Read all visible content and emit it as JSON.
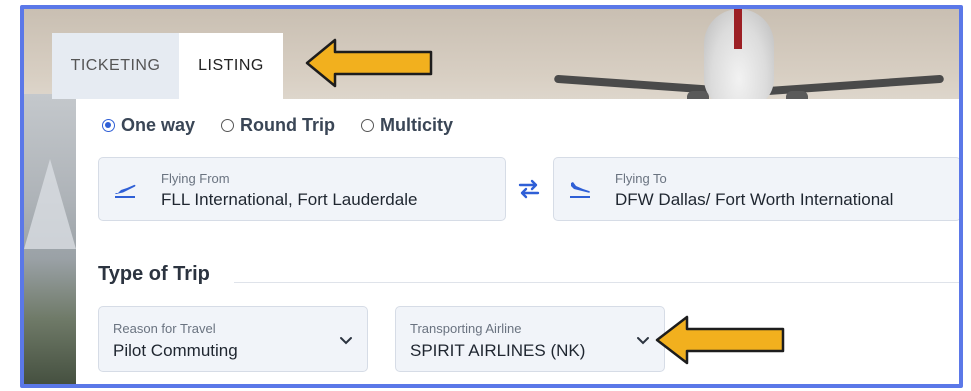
{
  "tabs": [
    {
      "label": "TICKETING",
      "active": false
    },
    {
      "label": "LISTING",
      "active": true
    }
  ],
  "trip_type": {
    "options": [
      {
        "label": "One way",
        "selected": true
      },
      {
        "label": "Round Trip",
        "selected": false
      },
      {
        "label": "Multicity",
        "selected": false
      }
    ]
  },
  "flying_from": {
    "label": "Flying From",
    "value": "FLL International, Fort Lauderdale",
    "icon": "takeoff-icon"
  },
  "flying_to": {
    "label": "Flying To",
    "value": "DFW Dallas/ Fort Worth International",
    "icon": "landing-icon"
  },
  "swap": {
    "icon": "swap-arrows-icon"
  },
  "type_of_trip": {
    "title": "Type of Trip"
  },
  "reason_for_travel": {
    "label": "Reason for Travel",
    "value": "Pilot Commuting"
  },
  "transporting_airline": {
    "label": "Transporting Airline",
    "value": "SPIRIT AIRLINES (NK)"
  },
  "colors": {
    "accent": "#2f5fd6",
    "frame": "#5b78e8",
    "annotation_arrow": "#f2b01e"
  }
}
